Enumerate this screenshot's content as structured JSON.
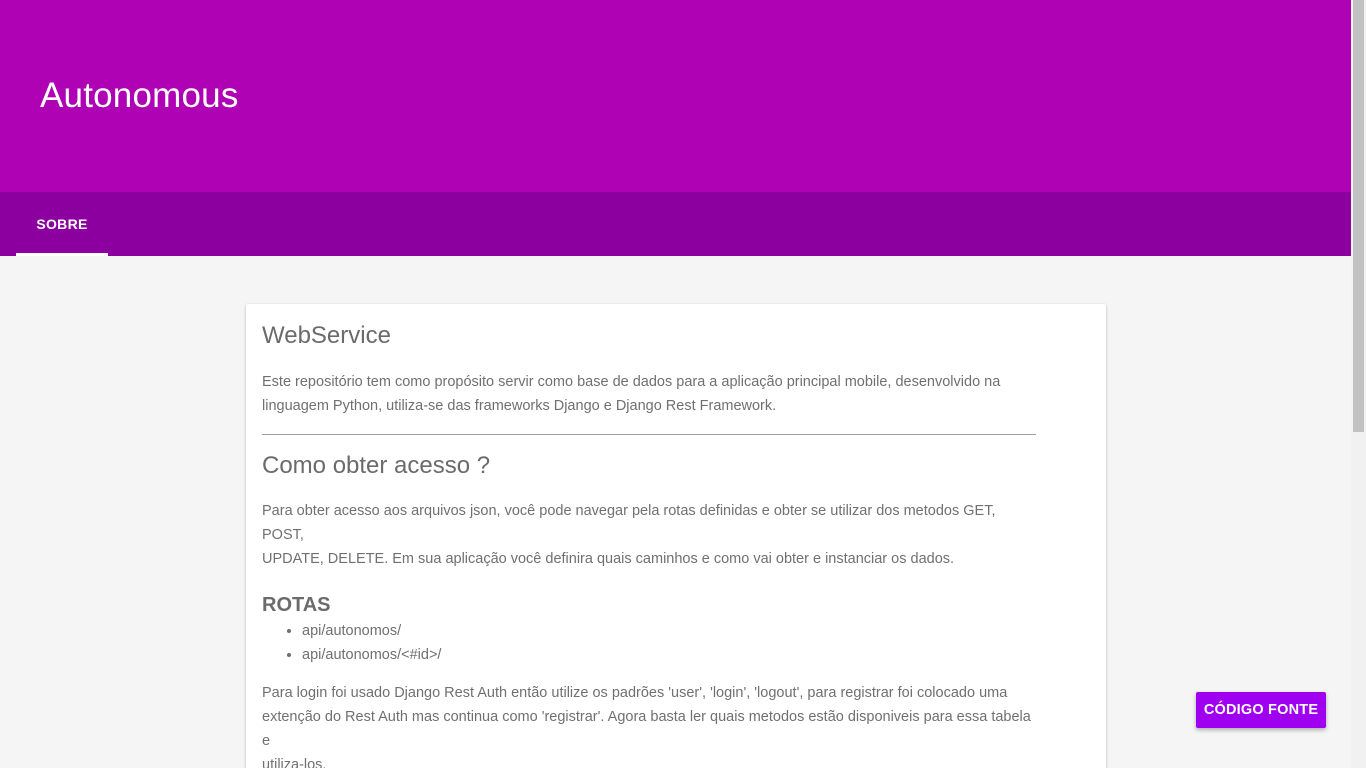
{
  "header": {
    "title": "Autonomous"
  },
  "tabs": [
    {
      "label": "SOBRE",
      "active": true
    }
  ],
  "card": {
    "section1": {
      "title": "WebService",
      "paragraph_line1": "Este repositório tem como propósito servir como base de dados para a aplicação principal mobile, desenvolvido na",
      "paragraph_line2": "linguagem Python, utiliza-se das frameworks Django e Django Rest Framework."
    },
    "section2": {
      "title": "Como obter acesso ?",
      "paragraph_line1": "Para obter acesso aos arquivos json, você pode navegar pela rotas definidas e obter se utilizar dos metodos GET, POST,",
      "paragraph_line2": "UPDATE, DELETE. Em sua aplicação você definira quais caminhos e como vai obter e instanciar os dados."
    },
    "routes": {
      "title": "ROTAS",
      "items": [
        "api/autonomos/",
        "api/autonomos/<#id>/"
      ]
    },
    "auth": {
      "line1": "Para login foi usado Django Rest Auth então utilize os padrões 'user', 'login', 'logout', para registrar foi colocado uma",
      "line2": "extenção do Rest Auth mas continua como 'registrar'. Agora basta ler quais metodos estão disponiveis para essa tabela e",
      "line3": "utiliza-los."
    }
  },
  "fab": {
    "label": "CÓDIGO FONTE"
  },
  "colors": {
    "header": "#ae02b4",
    "tabbar": "#8d00a0",
    "fab": "#a000f0",
    "background": "#f5f5f5"
  }
}
